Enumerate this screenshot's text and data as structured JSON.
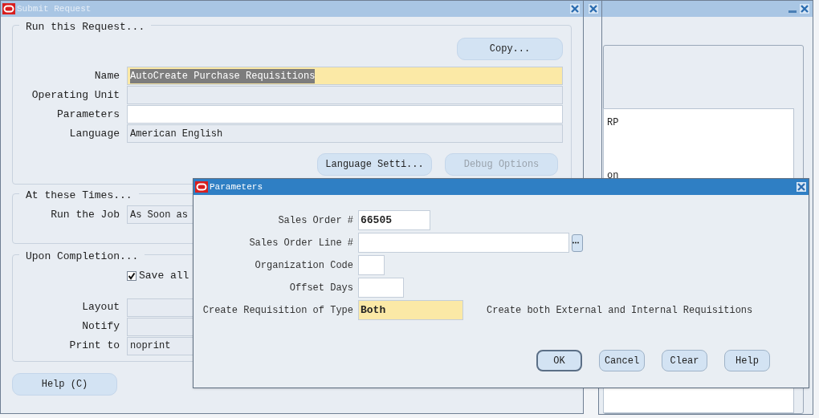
{
  "main_window": {
    "title": "Submit Request",
    "run_section": {
      "heading": "Run this Request...",
      "copy_button": "Copy...",
      "fields": [
        {
          "label": "Name",
          "value": "AutoCreate Purchase Requisitions",
          "kind": "required",
          "text_selected": true
        },
        {
          "label": "Operating Unit",
          "kind": "readonly"
        },
        {
          "label": "Parameters",
          "kind": "editable"
        },
        {
          "label": "Language",
          "value": "American English",
          "kind": "readonly",
          "text_selected": false
        }
      ],
      "buttons": [
        {
          "label": "Language Setti...",
          "disabled": false
        },
        {
          "label": "Debug Options",
          "disabled": true
        }
      ]
    },
    "times_section": {
      "heading": "At these Times...",
      "fields": [
        {
          "label": "Run the Job",
          "value": "As Soon as"
        }
      ]
    },
    "completion_section": {
      "heading": "Upon Completion...",
      "checkbox": {
        "label": "Save all",
        "checked": true
      },
      "fields": [
        {
          "label": "Layout"
        },
        {
          "label": "Notify"
        },
        {
          "label": "Print to",
          "value": "noprint"
        }
      ]
    },
    "help_button": "Help (C)"
  },
  "back_window": {
    "list_items": [
      "RP",
      "on"
    ]
  },
  "parameters_dialog": {
    "title": "Parameters",
    "fields": [
      {
        "label": "Sales Order #",
        "value": "66505",
        "kind": "editable"
      },
      {
        "label": "Sales Order Line #",
        "kind": "lov"
      },
      {
        "label": "Organization Code",
        "kind": "editable"
      },
      {
        "label": "Offset Days",
        "kind": "editable"
      },
      {
        "label": "Create Requisition of Type",
        "value": "Both",
        "kind": "required",
        "description": "Create both External and Internal Requisitions"
      }
    ],
    "buttons": [
      {
        "label": "OK",
        "default": true
      },
      {
        "label": "Cancel",
        "default": false
      },
      {
        "label": "Clear",
        "default": false
      },
      {
        "label": "Help",
        "default": false
      }
    ]
  }
}
